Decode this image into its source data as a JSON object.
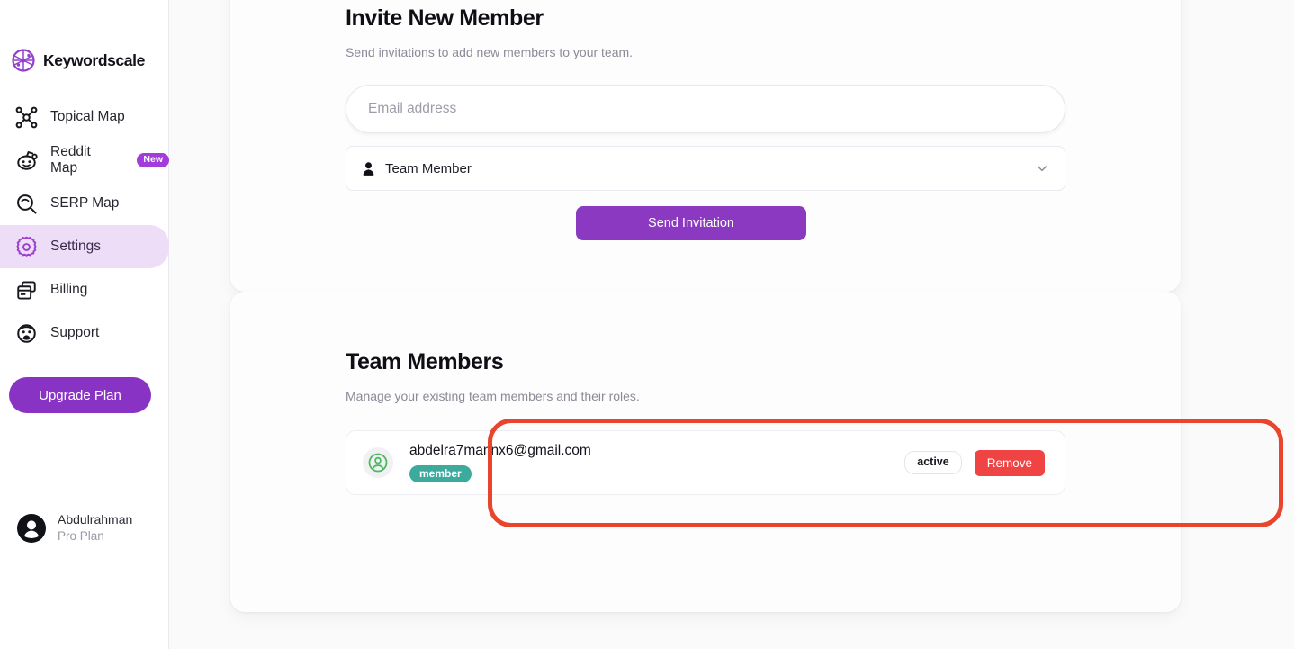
{
  "brand": {
    "name": "Keywordscale",
    "logo_icon": "network-globe-icon"
  },
  "sidebar": {
    "items": [
      {
        "label": "Topical Map",
        "icon": "topical-map-icon",
        "badge": null,
        "active": false
      },
      {
        "label": "Reddit Map",
        "icon": "reddit-icon",
        "badge": "New",
        "active": false
      },
      {
        "label": "SERP Map",
        "icon": "search-icon",
        "badge": null,
        "active": false
      },
      {
        "label": "Settings",
        "icon": "gear-icon",
        "badge": null,
        "active": true
      },
      {
        "label": "Billing",
        "icon": "credit-card-icon",
        "badge": null,
        "active": false
      },
      {
        "label": "Support",
        "icon": "support-agent-icon",
        "badge": null,
        "active": false
      }
    ],
    "upgrade_label": "Upgrade Plan",
    "user": {
      "name": "Abdulrahman",
      "plan": "Pro Plan",
      "avatar_icon": "user-circle-icon"
    }
  },
  "invite": {
    "title": "Invite New Member",
    "subtitle": "Send invitations to add new members to your team.",
    "email_placeholder": "Email address",
    "email_value": "",
    "role_value": "Team Member",
    "role_icon": "user-icon",
    "chevron_icon": "chevron-down-icon",
    "send_label": "Send Invitation"
  },
  "team": {
    "title": "Team Members",
    "subtitle": "Manage your existing team members and their roles.",
    "members": [
      {
        "email": "abdelra7mannx6@gmail.com",
        "role": "member",
        "status": "active",
        "remove_label": "Remove",
        "avatar_icon": "user-circle-icon"
      }
    ]
  },
  "colors": {
    "brand_purple": "#8833c4",
    "accent_purple": "#8a39c0",
    "nav_active_bg": "#eeddf7",
    "badge_new": "#a23ddb",
    "role_badge_teal": "#3cab9e",
    "remove_red": "#f04444",
    "annotation_red": "#e8452c",
    "avatar_green": "#4cb860",
    "page_bg": "#fafafb"
  }
}
